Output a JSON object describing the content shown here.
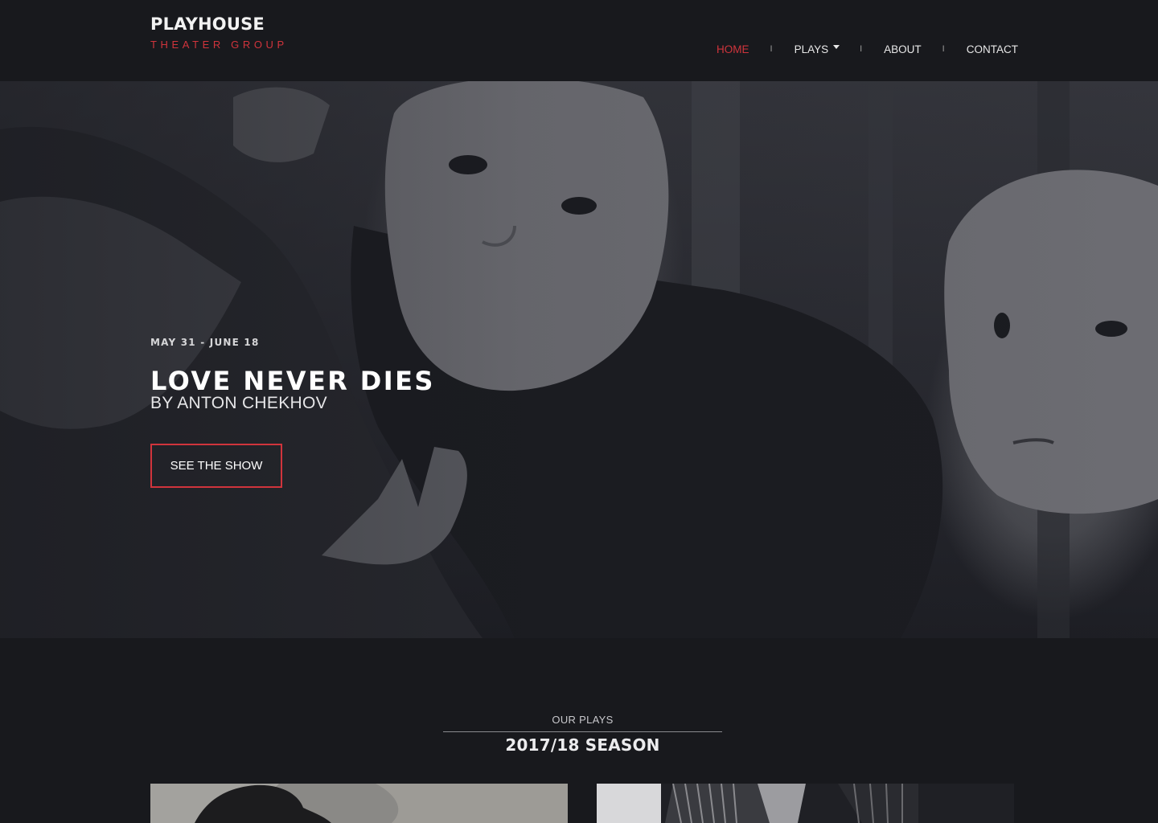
{
  "header": {
    "logo_main": "PLAYHOUSE",
    "logo_sub": "THEATER GROUP",
    "nav": [
      {
        "label": "HOME",
        "active": true
      },
      {
        "label": "PLAYS",
        "has_dropdown": true
      },
      {
        "label": "ABOUT"
      },
      {
        "label": "CONTACT"
      }
    ],
    "separator": "I"
  },
  "hero": {
    "date": "MAY 31 - JUNE 18",
    "title": "LOVE NEVER DIES",
    "author": "BY ANTON CHEKHOV",
    "button_label": "SEE THE SHOW"
  },
  "season": {
    "label": "OUR PLAYS",
    "title": "2017/18 SEASON"
  },
  "colors": {
    "accent": "#d0343c",
    "background": "#18191d"
  }
}
